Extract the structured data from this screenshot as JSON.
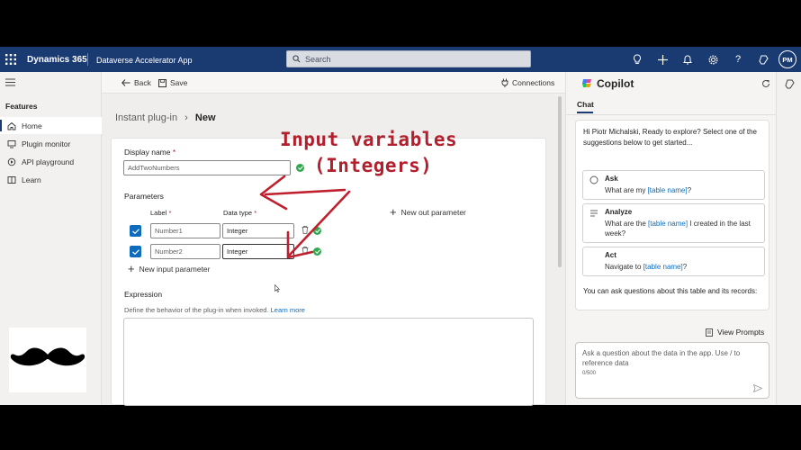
{
  "topbar": {
    "brand": "Dynamics 365",
    "app_name": "Dataverse Accelerator App",
    "search_placeholder": "Search",
    "avatar_initials": "PM"
  },
  "nav": {
    "section": "Features",
    "items": [
      {
        "label": "Home",
        "icon": "home-icon",
        "active": true
      },
      {
        "label": "Plugin monitor",
        "icon": "monitor-icon"
      },
      {
        "label": "API playground",
        "icon": "playground-icon"
      },
      {
        "label": "Learn",
        "icon": "book-icon"
      }
    ]
  },
  "cmdbar": {
    "back": "Back",
    "save": "Save",
    "connections": "Connections"
  },
  "breadcrumb": {
    "parent": "Instant plug-in",
    "current": "New"
  },
  "form": {
    "display_name_label": "Display name",
    "display_name_value": "AddTwoNumbers",
    "parameters_label": "Parameters",
    "col_label": "Label",
    "col_type": "Data type",
    "new_out_parameter": "New out parameter",
    "rows": [
      {
        "label": "Number1",
        "type": "Integer"
      },
      {
        "label": "Number2",
        "type": "Integer"
      }
    ],
    "new_input_parameter": "New input parameter",
    "expression_label": "Expression",
    "expression_desc": "Define the behavior of the plug-in when invoked.",
    "learn_more": "Learn more"
  },
  "annotation": {
    "line1": "Input variables",
    "line2": "(Integers)",
    "color": "#b21f2d"
  },
  "copilot": {
    "title": "Copilot",
    "tab": "Chat",
    "greeting": "Hi Piotr Michalski, Ready to explore? Select one of the suggestions below to get started...",
    "suggestions": [
      {
        "title": "Ask",
        "pre": "What are my ",
        "link": "[table name]",
        "post": "?"
      },
      {
        "title": "Analyze",
        "pre": "What are the ",
        "link": "[table name]",
        "post": " I created in the last week?"
      },
      {
        "title": "Act",
        "pre": "Navigate to ",
        "link": "[table name]",
        "post": "?"
      }
    ],
    "footer": "You can ask questions about this table and its records:",
    "view_prompts": "View Prompts",
    "input_placeholder": "Ask a question about the data in the app. Use / to reference data",
    "char_count": "0/500"
  },
  "colors": {
    "header": "#1a3a72",
    "accent": "#0f6cbd",
    "success": "#2fa84f"
  }
}
